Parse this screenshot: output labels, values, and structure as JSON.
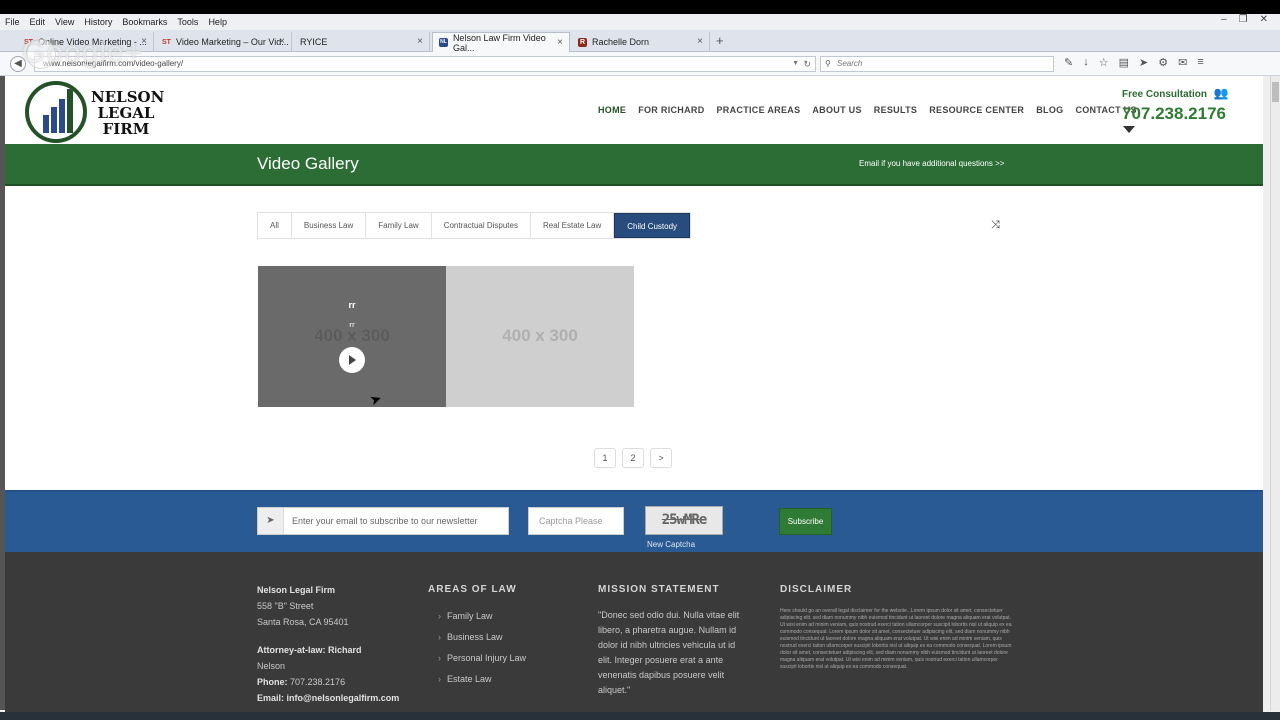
{
  "browser": {
    "menu": [
      "File",
      "Edit",
      "View",
      "History",
      "Bookmarks",
      "Tools",
      "Help"
    ],
    "tabs": [
      {
        "label": "Online Video Marketing - ...",
        "favicon": "ST"
      },
      {
        "label": "Video Marketing – Our Vid...",
        "favicon": "ST"
      },
      {
        "label": "RYICE",
        "favicon": ""
      },
      {
        "label": "Nelson Law Firm Video Gal...",
        "favicon": "NL"
      },
      {
        "label": "Rachelle Dorn",
        "favicon": "R"
      }
    ],
    "url": "www.nelsonlegalfirm.com/video-gallery/",
    "search_placeholder": "Search",
    "overlay_text": "Google+"
  },
  "site": {
    "logo_text": [
      "NELSON",
      "LEGAL",
      "FIRM"
    ],
    "nav": [
      "HOME",
      "FOR RICHARD",
      "PRACTICE AREAS",
      "ABOUT US",
      "RESULTS",
      "RESOURCE CENTER",
      "BLOG",
      "CONTACT US"
    ],
    "consult_label": "Free Consultation",
    "phone": "707.238.2176",
    "page_title": "Video Gallery",
    "email_link": "Email if you have additional questions >>",
    "filters": [
      "All",
      "Business Law",
      "Family Law",
      "Contractual Disputes",
      "Real Estate Law",
      "Child Custody"
    ],
    "active_filter": "Child Custody",
    "thumbs": [
      {
        "placeholder": "400 x 300",
        "title_top": "rr",
        "title_mid": "rr"
      },
      {
        "placeholder": "400 x 300"
      }
    ],
    "pager": [
      "1",
      "2",
      ">"
    ],
    "newsletter": {
      "placeholder": "Enter your email to subscribe to our newsletter",
      "captcha_placeholder": "Captcha Please",
      "captcha_code": "25wMRe",
      "new_captcha": "New Captcha",
      "subscribe": "Subscribe"
    },
    "footer": {
      "firm_name": "Nelson Legal Firm",
      "address1": "558 \"B\" Street",
      "address2": "Santa Rosa, CA 95401",
      "attorney": "Attorney-at-law: Richard",
      "attorney2": "Nelson",
      "phone_label": "Phone:",
      "phone": "707.238.2176",
      "email": "Email: info@nelsonlegalfirm.com",
      "areas_heading": "AREAS OF LAW",
      "areas": [
        "Family Law",
        "Business Law",
        "Personal Injury Law",
        "Estate Law"
      ],
      "mission_heading": "MISSION STATEMENT",
      "mission_text": "\"Donec sed odio dui. Nulla vitae elit libero, a pharetra augue. Nullam id dolor id nibh ultricies vehicula ut id elit. Integer posuere erat a ante venenatis dapibus posuere velit aliquet.\"",
      "disclaimer_heading": "DISCLAIMER",
      "disclaimer_text": "Here should go an overall legal disclaimer for the website...Lorem ipsum dolor sit amet, consectetuer adipiscing elit, sed diam nonummy nibh euismod tincidunt ut laoreet dolore magna aliquam erat volutpat. Ut wisi enim ad minim veniam, quis nostrud exerci tation ullamcorper suscipit lobortis nisl ut aliquip ex ea commodo consequat. Lorem ipsum dolor sit amet, consectetuer adipiscing elit, sed diam nonummy nibh euismod tincidunt ut laoreet dolore magna aliquam erat volutpat. Ut wisi enim ad minim veniam, quis nostrud exerci tation ullamcorper suscipit lobortis nisl ut aliquip ex ea commodo consequat. Lorem ipsum dolor sit amet, consectetuer adipiscing elit, sed diam nonummy nibh euismod tincidunt ut laoreet dolore magna aliquam erat volutpat. Ut wisi enim ad minim veniam, quis nostrud exerci tation ullamcorper suscipit lobortis nisl ut aliquip ex ea commodo consequat."
    }
  },
  "colors": {
    "green": "#2b6d35",
    "blue": "#2a5a93",
    "active_filter": "#284c7e",
    "footer": "#3a3a3a"
  }
}
